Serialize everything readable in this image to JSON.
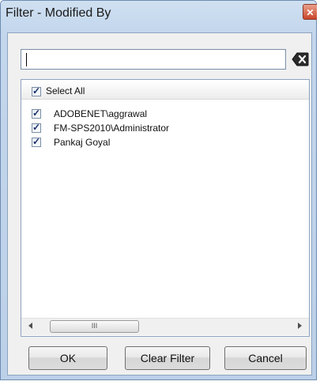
{
  "window": {
    "title": "Filter - Modified By",
    "close_glyph": "✕"
  },
  "search": {
    "value": "",
    "placeholder": ""
  },
  "list": {
    "select_all_label": "Select All",
    "select_all_checked": true,
    "items": [
      {
        "label": "ADOBENET\\aggrawal",
        "checked": true
      },
      {
        "label": "FM-SPS2010\\Administrator",
        "checked": true
      },
      {
        "label": "Pankaj Goyal",
        "checked": true
      }
    ],
    "check_glyph": "✓"
  },
  "scrollbar": {
    "thumb_grip": "III"
  },
  "buttons": {
    "ok": "OK",
    "clear_filter": "Clear Filter",
    "cancel": "Cancel"
  },
  "icons": {
    "close": "close-icon",
    "clear_search": "clear-search-icon",
    "scroll_left": "scroll-left-arrow-icon",
    "scroll_right": "scroll-right-arrow-icon"
  },
  "colors": {
    "close_button": "#c9452a",
    "check": "#1a2f6b",
    "titlebar": "#cfe0f1"
  }
}
